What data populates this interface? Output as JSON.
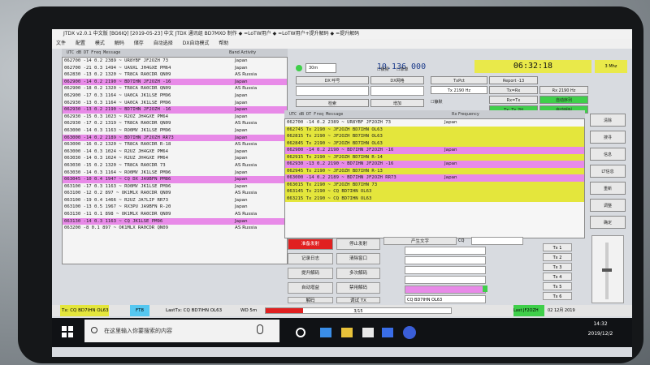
{
  "window": {
    "title": "JTDX  v2.0.1 中文版  [BG6IQ] [2019-05-23] 中文 JTDX 通讯组 BD7MXO 制作  ◆ =LoTW用户  ◆ =LoTW用户+提升解码  ◆ =提升解码"
  },
  "menu": [
    "文件",
    "配置",
    "模式",
    "解码",
    "储存",
    "自动选择",
    "DX自动模式",
    "帮助"
  ],
  "left_panel": {
    "header": "UTC  dB  DT Freq  Message",
    "band_activity": "Band Activity",
    "rows": [
      {
        "text": "062700 -14  0.2 2389 ~ UR8YBF JF2OZH 73",
        "country": "Japan",
        "hl": ""
      },
      {
        "text": "062700 -21  0.3 1494 ~ UA9XL JH4GXE PM64",
        "country": "Japan",
        "hl": ""
      },
      {
        "text": "062830 -13  0.2 1320 ~ TR8CA RA0CDR QN09",
        "country": "AS Russia",
        "hl": ""
      },
      {
        "text": "062900 -14  0.2 2190 ~ BD7IHN JF2OZH -16",
        "country": "Japan",
        "hl": "m"
      },
      {
        "text": "062900 -18  0.2 1320 ~ TR8CA RA0CDR QN09",
        "country": "AS Russia",
        "hl": ""
      },
      {
        "text": "062900 -17  0.3 1164 ~ UA0CA JK1LSE PM96",
        "country": "Japan",
        "hl": ""
      },
      {
        "text": "062930 -13  0.3 1164 ~ UA0CA JK1LSE PM96",
        "country": "Japan",
        "hl": ""
      },
      {
        "text": "062930 -13  0.2 2190 ~ BD7IHN JF2OZH -16",
        "country": "Japan",
        "hl": "m"
      },
      {
        "text": "062930 -15  0.3 1023 ~ R2OZ JH4GXE PM64",
        "country": "Japan",
        "hl": ""
      },
      {
        "text": "062930 -17  0.2 1319 ~ TR8CA RA0CDR QN09",
        "country": "AS Russia",
        "hl": ""
      },
      {
        "text": "063000 -14  0.3 1163 ~ RO0MV JK1LSE PM96",
        "country": "Japan",
        "hl": ""
      },
      {
        "text": "063000 -14  0.2 2189 ~ BD7IHN JF2OZH RR73",
        "country": "Japan",
        "hl": "m"
      },
      {
        "text": "063000 -16  0.2 1320 ~ TR8CA RA0CDR R-18",
        "country": "AS Russia",
        "hl": ""
      },
      {
        "text": "063000 -14  0.3 1024 ~ R2UZ JH4GXE PM64",
        "country": "Japan",
        "hl": ""
      },
      {
        "text": "063030 -14  0.3 1024 ~ R2UZ JH4GXE PM64",
        "country": "Japan",
        "hl": ""
      },
      {
        "text": "063030 -15  0.2 1320 ~ TR8CA RA0CDR 73",
        "country": "AS Russia",
        "hl": ""
      },
      {
        "text": "063030 -14  0.3 1164 ~ RO0MV JK1LSE PM96",
        "country": "Japan",
        "hl": ""
      },
      {
        "text": "063045 -10  0.4 1947 ~ CQ DX JA9BFN PM86",
        "country": "Japan",
        "hl": "m"
      },
      {
        "text": "063100 -17  0.3 1163 ~ RO0MV JK1LSE PM96",
        "country": "Japan",
        "hl": ""
      },
      {
        "text": "063100 -12  0.2  897 ~ OK1MLX RA0CDR QN09",
        "country": "AS Russia",
        "hl": ""
      },
      {
        "text": "063100 -19  0.4 1466 ~ R2UZ JA7LIP RR73",
        "country": "Japan",
        "hl": ""
      },
      {
        "text": "063100 -13  0.5 1967 ~ RX3PU JA9BFN R-20",
        "country": "Japan",
        "hl": ""
      },
      {
        "text": "063130 -11  0.1  898 ~ OK1MLX RA0CDR QN09",
        "country": "AS Russia",
        "hl": ""
      },
      {
        "text": "063130 -14  0.3 1163 ~ CQ JK1LSE PM96",
        "country": "Japan",
        "hl": "m"
      },
      {
        "text": "063200  -8  0.1  897 ~ OK1MLX RA0CDR QN09",
        "country": "AS Russia",
        "hl": ""
      }
    ]
  },
  "right_top": {
    "frequency": "10.136  000",
    "clock": "06:32:18",
    "date_badge": "3 Mhz",
    "band": "30m",
    "dx_call_label": "DX 呼号",
    "dx_grid_label": "DX网格",
    "lookup": "检索",
    "add": "增加",
    "cb_hold": "锁频",
    "cb_single": "单单",
    "cb_mute": "静默",
    "tx_freq": "Tx 2190 Hz",
    "rx_freq": "Rx 2190 Hz",
    "tx_pct": "TxPct",
    "report": "Report -13",
    "tx_rx_btn": "Tx=Rx",
    "rx_tx_btn": "Rx=Tx",
    "auto_seq": "自动序列",
    "auto_call": "自动呼叫",
    "tx_grid": "Tx: Tx 2H",
    "rx_freq_hdr": "Rx Frequency"
  },
  "decode_panel": {
    "header": "UTC  dB  DT Freq  Message",
    "rows": [
      {
        "text": "062700 -14  0.2 2389 ~ UR8YBF JF2OZH 73",
        "country": "Japan",
        "hl": ""
      },
      {
        "text": "062745  Tx      2190 ~ JF2OZH BD7IHN OL63",
        "country": "",
        "hl": "y"
      },
      {
        "text": "062815  Tx      2190 ~ JF2OZH BD7IHN OL63",
        "country": "",
        "hl": "y"
      },
      {
        "text": "062845  Tx      2190 ~ JF2OZH BD7IHN OL63",
        "country": "",
        "hl": "y"
      },
      {
        "text": "062900 -14  0.2 2190 ~ BD7IHN JF2OZH -16",
        "country": "Japan",
        "hl": "m"
      },
      {
        "text": "062915  Tx      2190 ~ JF2OZH BD7IHN R-14",
        "country": "",
        "hl": "y"
      },
      {
        "text": "062930 -13  0.2 2190 ~ BD7IHN JF2OZH -16",
        "country": "Japan",
        "hl": "m"
      },
      {
        "text": "062945  Tx      2190 ~ JF2OZH BD7IHN R-13",
        "country": "",
        "hl": "y"
      },
      {
        "text": "063000 -14  0.2 2189 ~ BD7IHN JF2OZH RR73",
        "country": "Japan",
        "hl": "m"
      },
      {
        "text": "063015  Tx      2190 ~ JF2OZH BD7IHN 73",
        "country": "",
        "hl": "y"
      },
      {
        "text": "063145  Tx      2190 ~ CQ BD7IHN OL63",
        "country": "",
        "hl": "y"
      },
      {
        "text": "063215  Tx      2190 ~ CQ BD7IHN OL63",
        "country": "",
        "hl": "y"
      }
    ]
  },
  "side_buttons": [
    "清除",
    "搜寻",
    "信息",
    "LT信息",
    "重新",
    "调整",
    "确定"
  ],
  "bottom_buttons": {
    "tx_enable": "准备发射",
    "stop_tx": "停止发射",
    "log_qso": "记录日志",
    "erase": "清除窗口",
    "decode": "提升解码",
    "multi": "多次解码",
    "auto_tune": "自动增益",
    "hold_decode": "禁用解码",
    "decode2": "解码",
    "tune": "调试 TX",
    "gen_msgs": "产生文字",
    "cq_label": "CQ",
    "tx_box": "CQ BD7IHN OL63"
  },
  "tx_buttons": [
    "Tx 1",
    "Tx 2",
    "Tx 3",
    "Tx 4",
    "Tx 5",
    "Tx 6"
  ],
  "status": {
    "tx": "Tx: CQ BD7IHN OL63",
    "mode": "FT8",
    "last_tx": "LastTx: CQ BD7IHN OL63",
    "wd": "WD 5m",
    "progress_label": "3/15",
    "progress": 0.2,
    "last_cq": "Last JF2OZH",
    "date": "02 12月 2019"
  },
  "taskbar": {
    "search_placeholder": "在这里输入你要搜索的内容",
    "time": "14:32",
    "date": "2019/12/2"
  },
  "colors": {
    "magenta": "#e88ae8",
    "yellow": "#e4e63c",
    "green": "#3fcf4a",
    "red": "#e02020",
    "blue_freq": "#1a3a8a"
  }
}
